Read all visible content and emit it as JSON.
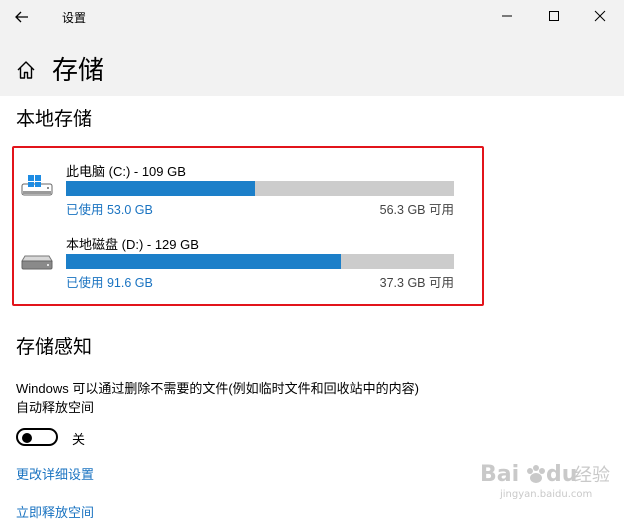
{
  "window": {
    "title": "设置",
    "icons": [
      "back-arrow-icon",
      "minimize-icon",
      "maximize-icon",
      "close-icon"
    ]
  },
  "header": {
    "title": "存储",
    "home_icon": "home-icon"
  },
  "local_storage": {
    "title": "本地存储",
    "drives": [
      {
        "name": "此电脑 (C:) - 109 GB",
        "used": "已使用 53.0 GB",
        "free": "56.3 GB 可用",
        "used_fraction": 0.486,
        "icon": "windows-drive-icon"
      },
      {
        "name": "本地磁盘 (D:) - 129 GB",
        "used": "已使用 91.6 GB",
        "free": "37.3 GB 可用",
        "used_fraction": 0.71,
        "icon": "drive-icon"
      }
    ]
  },
  "storage_sense": {
    "title": "存储感知",
    "description_line1": "Windows 可以通过删除不需要的文件(例如临时文件和回收站中的内容)",
    "description_line2": "自动释放空间",
    "toggle_state": "关",
    "link_change": "更改详细设置",
    "link_free": "立即释放空间"
  },
  "watermark": {
    "brand": "Bai",
    "brand2": "du",
    "chinese": "经验",
    "url": "jingyan.baidu.com"
  },
  "colors": {
    "accent": "#1c7fc9",
    "link": "#1a73c1",
    "highlight": "#e2141b",
    "bar_bg": "#cccccc",
    "chrome_bg": "#f2f2f2"
  }
}
